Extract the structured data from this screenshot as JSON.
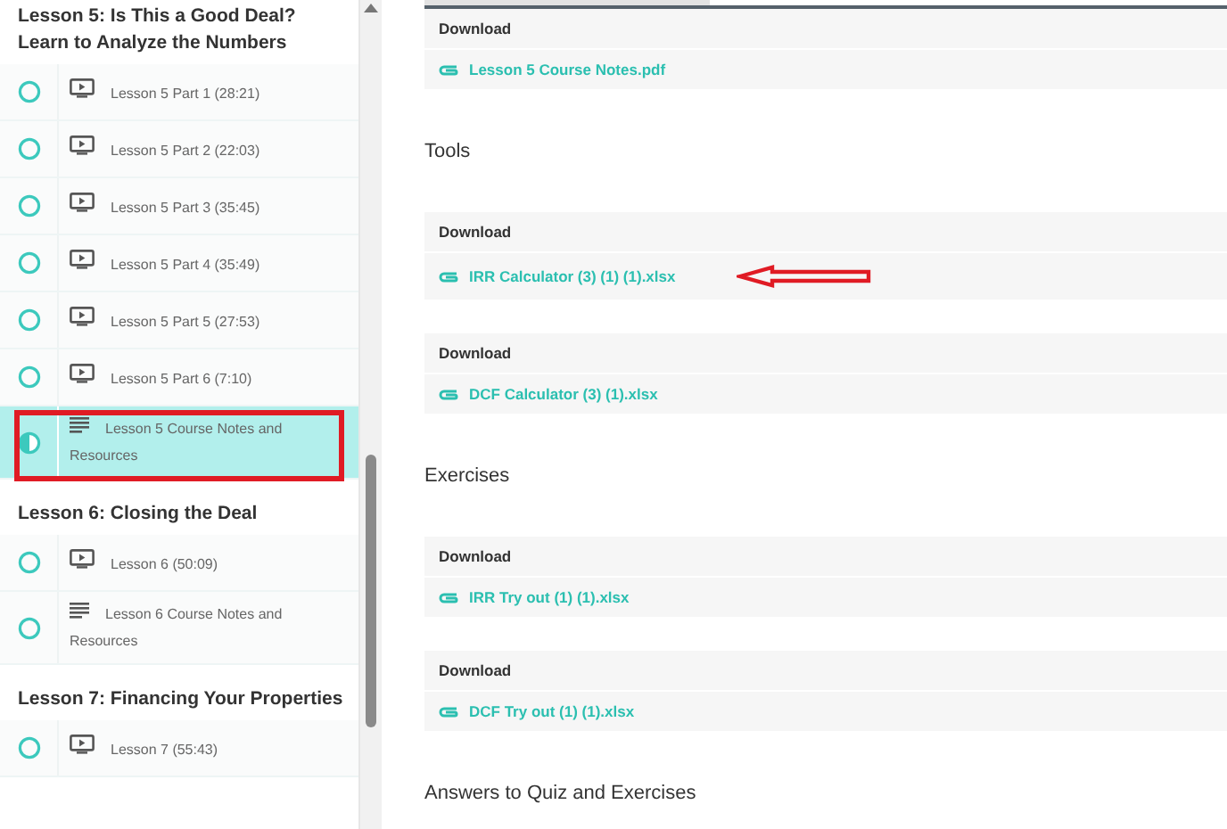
{
  "sidebar": {
    "sections": [
      {
        "title": "Lesson 5: Is This a Good Deal? Learn to Analyze the Numbers",
        "items": [
          {
            "kind": "video",
            "label": "Lesson 5 Part 1 (28:21)",
            "started": false,
            "selected": false
          },
          {
            "kind": "video",
            "label": "Lesson 5 Part 2 (22:03)",
            "started": false,
            "selected": false
          },
          {
            "kind": "video",
            "label": "Lesson 5 Part 3 (35:45)",
            "started": false,
            "selected": false
          },
          {
            "kind": "video",
            "label": "Lesson 5 Part 4 (35:49)",
            "started": false,
            "selected": false
          },
          {
            "kind": "video",
            "label": "Lesson 5 Part 5 (27:53)",
            "started": false,
            "selected": false
          },
          {
            "kind": "video",
            "label": "Lesson 5 Part 6 (7:10)",
            "started": false,
            "selected": false
          },
          {
            "kind": "text",
            "label": "Lesson 5 Course Notes and Resources",
            "started": true,
            "selected": true,
            "annotated": true
          }
        ]
      },
      {
        "title": "Lesson 6: Closing the Deal",
        "items": [
          {
            "kind": "video",
            "label": "Lesson 6 (50:09)",
            "started": false,
            "selected": false
          },
          {
            "kind": "text",
            "label": "Lesson 6 Course Notes and Resources",
            "started": false,
            "selected": false
          }
        ]
      },
      {
        "title": "Lesson 7: Financing Your Properties",
        "items": [
          {
            "kind": "video",
            "label": "Lesson 7 (55:43)",
            "started": false,
            "selected": false
          }
        ]
      }
    ]
  },
  "content": {
    "sections": [
      {
        "downloads": [
          {
            "header": "Download",
            "file": "Lesson 5 Course Notes.pdf"
          }
        ]
      },
      {
        "heading": "Tools",
        "downloads": [
          {
            "header": "Download",
            "file": "IRR Calculator (3) (1) (1).xlsx",
            "annotated": true
          },
          {
            "header": "Download",
            "file": "DCF Calculator (3) (1).xlsx"
          }
        ]
      },
      {
        "heading": "Exercises",
        "downloads": [
          {
            "header": "Download",
            "file": "IRR Try out (1) (1).xlsx"
          },
          {
            "header": "Download",
            "file": "DCF Try out (1) (1).xlsx"
          }
        ]
      },
      {
        "heading": "Answers to Quiz and Exercises"
      }
    ]
  }
}
